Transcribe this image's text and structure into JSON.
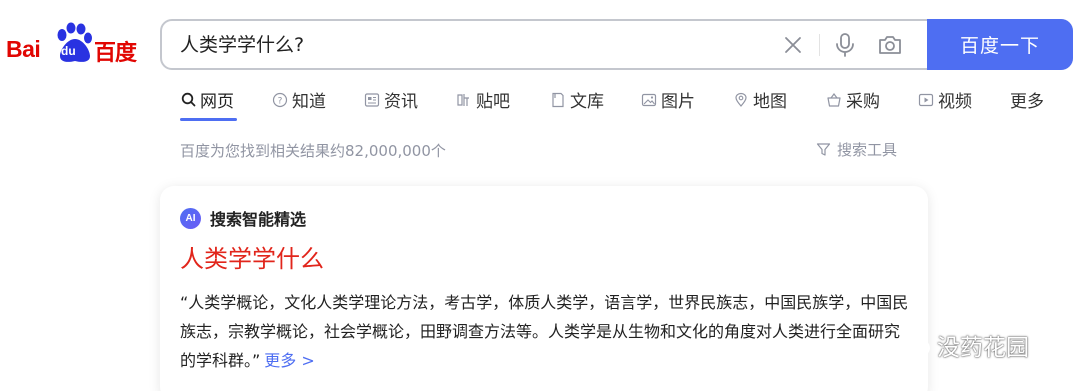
{
  "logo": {
    "text_latin": "Bai",
    "text_du": "du",
    "text_cn": "百度"
  },
  "search": {
    "query": "人类学学什么?",
    "button_label": "百度一下"
  },
  "tabs": [
    {
      "label": "网页",
      "icon": "search-icon"
    },
    {
      "label": "知道",
      "icon": "question-circle-icon"
    },
    {
      "label": "资讯",
      "icon": "news-icon"
    },
    {
      "label": "贴吧",
      "icon": "tieba-icon"
    },
    {
      "label": "文库",
      "icon": "document-icon"
    },
    {
      "label": "图片",
      "icon": "image-icon"
    },
    {
      "label": "地图",
      "icon": "map-pin-icon"
    },
    {
      "label": "采购",
      "icon": "shopping-basket-icon"
    },
    {
      "label": "视频",
      "icon": "video-play-icon"
    },
    {
      "label": "更多",
      "icon": ""
    }
  ],
  "results": {
    "count_text": "百度为您找到相关结果约82,000,000个",
    "tools_label": "搜索工具"
  },
  "card": {
    "ai_icon_text": "AI",
    "ai_label": "搜索智能精选",
    "title": "人类学学什么",
    "body": "“人类学概论，文化人类学理论方法，考古学，体质人类学，语言学，世界民族志，中国民族学，中国民族志，宗教学概论，社会学概论，田野调查方法等。人类学是从生物和文化的角度对人类进行全面研究的学科群。”",
    "more_label": "更多 >"
  },
  "watermark": {
    "text": "没药花园"
  },
  "colors": {
    "brand_red": "#e10602",
    "accent_blue": "#4e6ef2",
    "title_red": "#e1251b",
    "muted_gray": "#9195a3"
  }
}
